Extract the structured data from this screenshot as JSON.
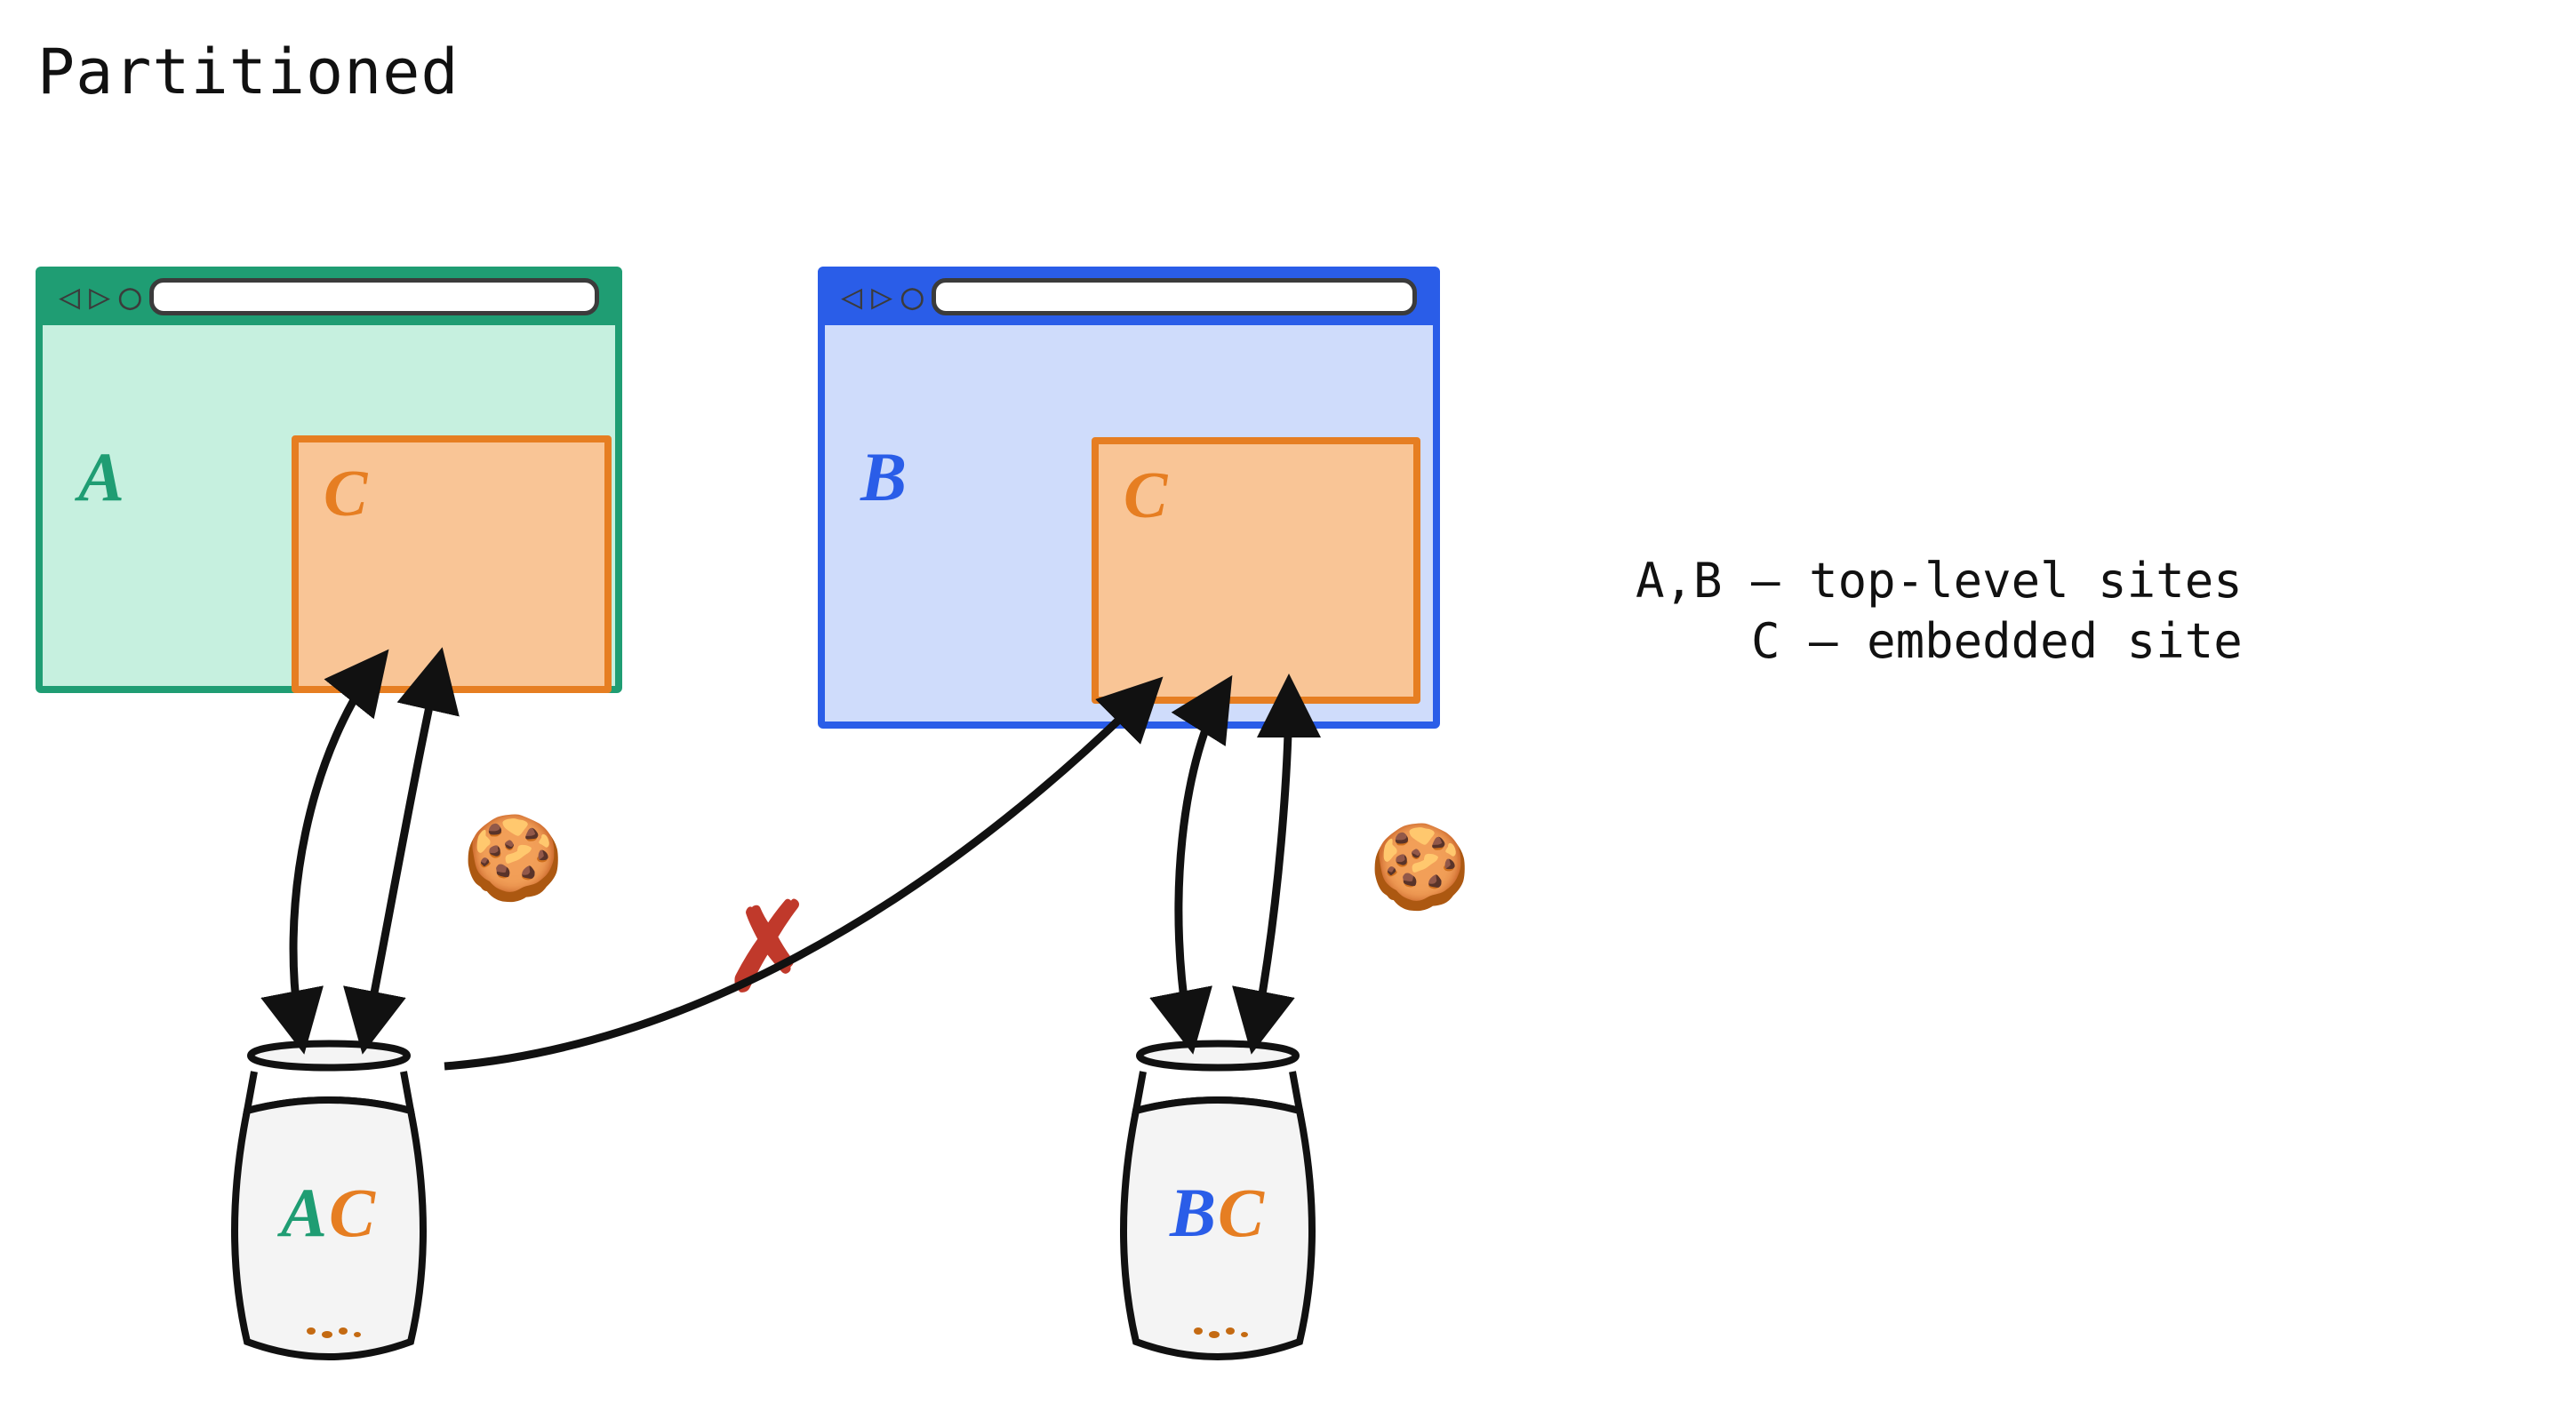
{
  "title": "Partitioned",
  "legend": {
    "line1": "A,B – top-level sites",
    "line2": "  C – embedded site"
  },
  "windows": {
    "A": {
      "label": "A",
      "embedLabel": "C"
    },
    "B": {
      "label": "B",
      "embedLabel": "C"
    }
  },
  "jars": {
    "AC": {
      "a": "A",
      "c": "C"
    },
    "BC": {
      "b": "B",
      "c": "C"
    }
  },
  "symbols": {
    "cookie": "🍪",
    "cross": "✗"
  },
  "colors": {
    "greenSite": "#1f9d73",
    "blueSite": "#2a5de8",
    "embedOrange": "#e67e22",
    "crossRed": "#c0392b",
    "ink": "#111111"
  },
  "toolbar_glyphs": {
    "back": "◁",
    "fwd": "▷",
    "reload": "◯"
  }
}
